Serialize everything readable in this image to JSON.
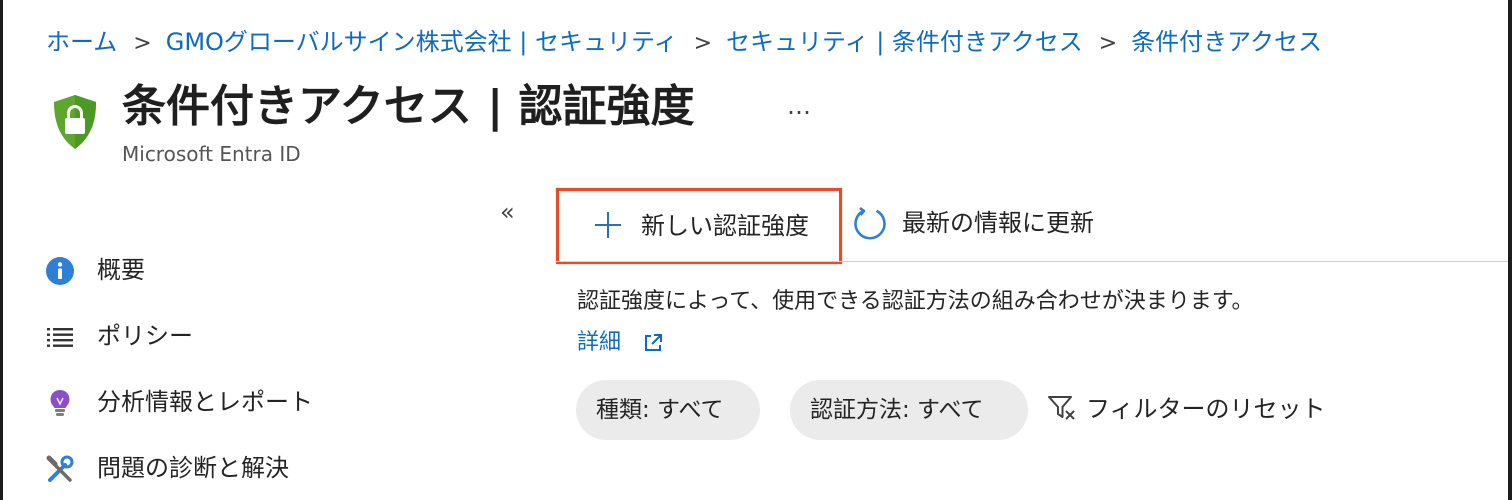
{
  "breadcrumb": [
    {
      "label": "ホーム"
    },
    {
      "label": "GMOグローバルサイン株式会社 | セキュリティ"
    },
    {
      "label": "セキュリティ | 条件付きアクセス"
    },
    {
      "label": "条件付きアクセス"
    }
  ],
  "breadcrumb_separator": ">",
  "header": {
    "title": "条件付きアクセス | 認証強度",
    "more_label": "…",
    "subtitle": "Microsoft Entra ID"
  },
  "sidebar": {
    "collapse_label": "«",
    "items": [
      {
        "label": "概要",
        "icon": "info-icon"
      },
      {
        "label": "ポリシー",
        "icon": "list-icon"
      },
      {
        "label": "分析情報とレポート",
        "icon": "lightbulb-icon"
      },
      {
        "label": "問題の診断と解決",
        "icon": "wrench-screwdriver-icon"
      }
    ]
  },
  "toolbar": {
    "new_label": "新しい認証強度",
    "refresh_label": "最新の情報に更新"
  },
  "content": {
    "description": "認証強度によって、使用できる認証方法の組み合わせが決まります。",
    "learn_more": "詳細"
  },
  "filters": {
    "type_filter": "種類: すべて",
    "method_filter": "認証方法: すべて",
    "reset_label": "フィルターのリセット"
  },
  "colors": {
    "link": "#0f6cbd",
    "highlight_border": "#e84a2c",
    "shield_green": "#5ea72f",
    "pill_background": "#ebebeb"
  }
}
